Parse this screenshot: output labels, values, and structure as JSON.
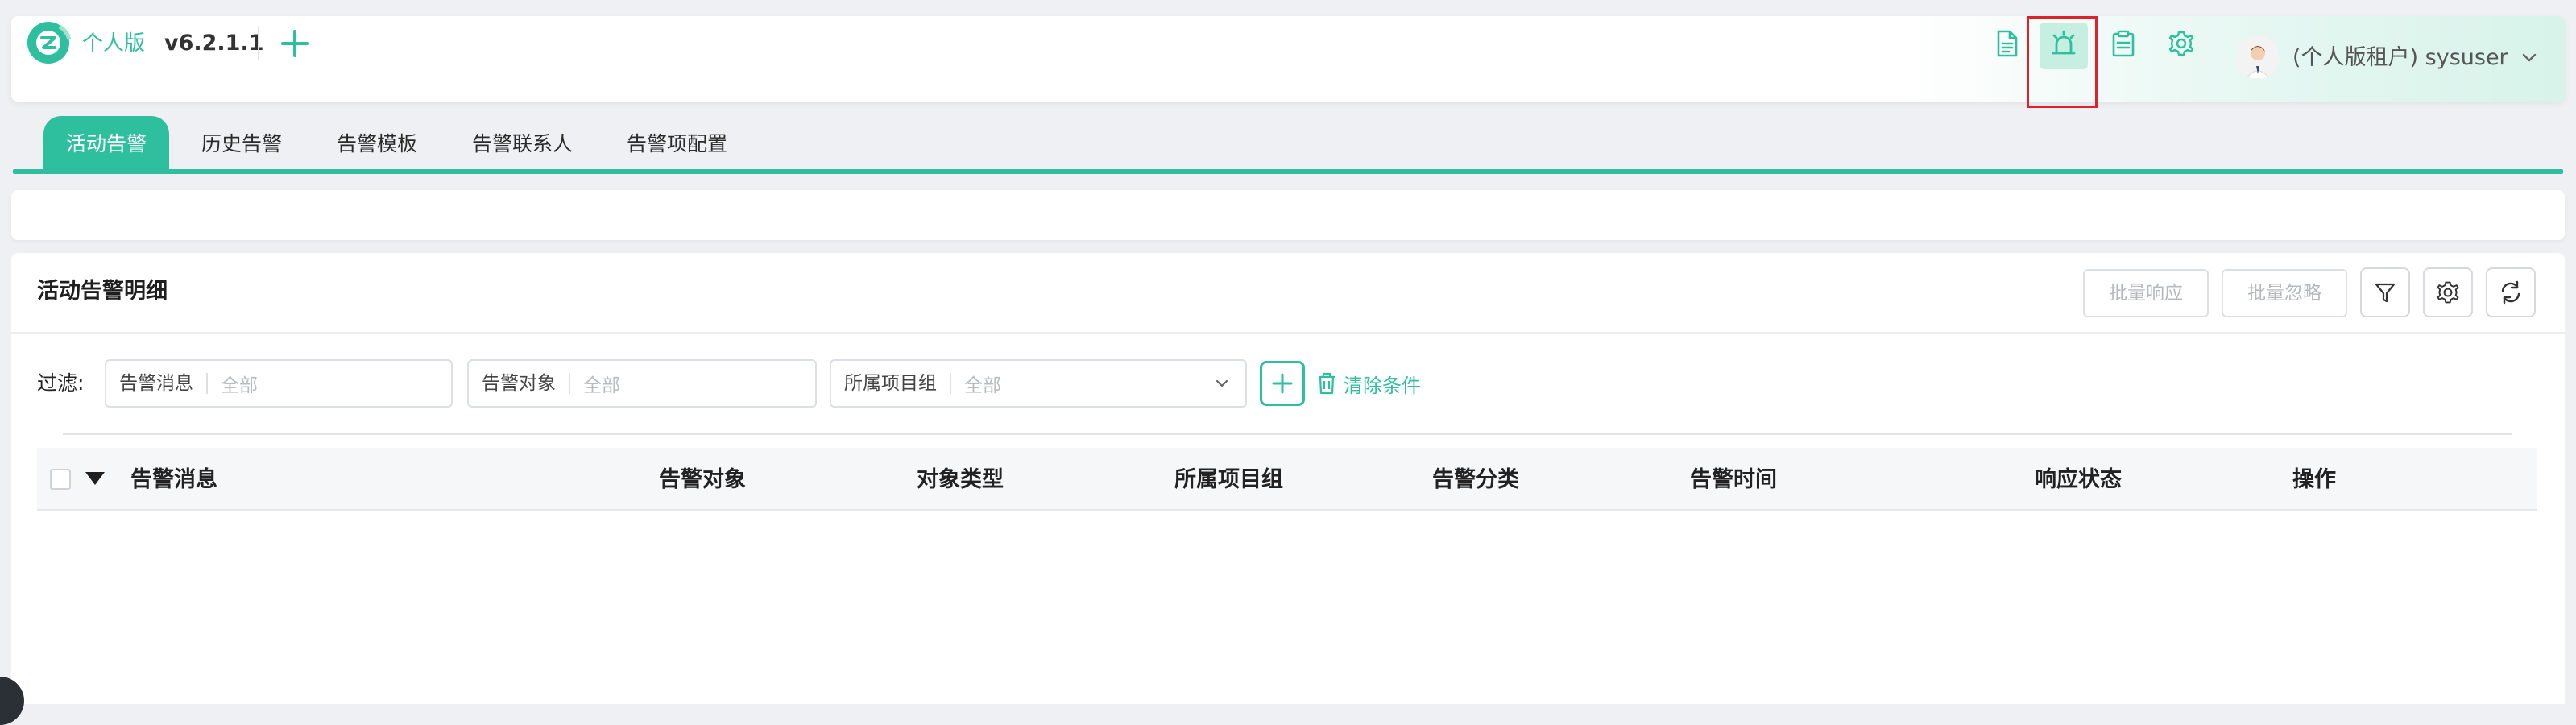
{
  "header": {
    "brand_name": "个人版",
    "version": "v6.2.1.1",
    "user": "(个人版租户) sysuser",
    "icons": [
      "document-icon",
      "alarm-icon",
      "clipboard-icon",
      "gear-icon"
    ]
  },
  "tabs": [
    {
      "label": "活动告警",
      "active": true
    },
    {
      "label": "历史告警",
      "active": false
    },
    {
      "label": "告警模板",
      "active": false
    },
    {
      "label": "告警联系人",
      "active": false
    },
    {
      "label": "告警项配置",
      "active": false
    }
  ],
  "card": {
    "title": "活动告警明细",
    "batch_respond": "批量响应",
    "batch_ignore": "批量忽略"
  },
  "filters": {
    "label": "过滤:",
    "items": [
      {
        "label": "告警消息",
        "value": "全部"
      },
      {
        "label": "告警对象",
        "value": "全部"
      },
      {
        "label": "所属项目组",
        "value": "全部"
      }
    ],
    "clear_label": "清除条件"
  },
  "table": {
    "columns": [
      "告警消息",
      "告警对象",
      "对象类型",
      "所属项目组",
      "告警分类",
      "告警时间",
      "响应状态",
      "操作"
    ],
    "rows": []
  },
  "colors": {
    "accent": "#2ebf9f",
    "highlight_border": "#e0202a"
  }
}
